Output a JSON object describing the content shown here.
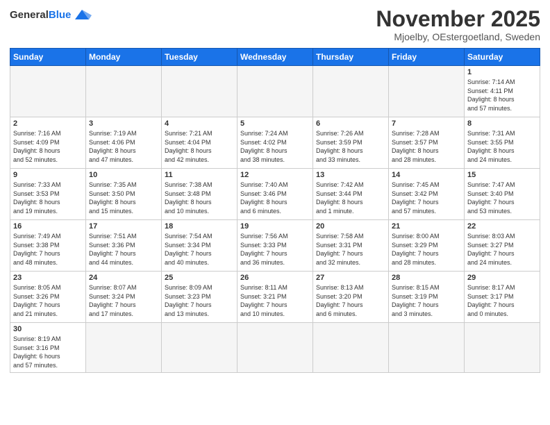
{
  "header": {
    "logo_general": "General",
    "logo_blue": "Blue",
    "month": "November 2025",
    "location": "Mjoelby, OEstergoetland, Sweden"
  },
  "weekdays": [
    "Sunday",
    "Monday",
    "Tuesday",
    "Wednesday",
    "Thursday",
    "Friday",
    "Saturday"
  ],
  "days": [
    {
      "num": "",
      "info": ""
    },
    {
      "num": "",
      "info": ""
    },
    {
      "num": "",
      "info": ""
    },
    {
      "num": "",
      "info": ""
    },
    {
      "num": "",
      "info": ""
    },
    {
      "num": "",
      "info": ""
    },
    {
      "num": "1",
      "info": "Sunrise: 7:14 AM\nSunset: 4:11 PM\nDaylight: 8 hours\nand 57 minutes."
    },
    {
      "num": "2",
      "info": "Sunrise: 7:16 AM\nSunset: 4:09 PM\nDaylight: 8 hours\nand 52 minutes."
    },
    {
      "num": "3",
      "info": "Sunrise: 7:19 AM\nSunset: 4:06 PM\nDaylight: 8 hours\nand 47 minutes."
    },
    {
      "num": "4",
      "info": "Sunrise: 7:21 AM\nSunset: 4:04 PM\nDaylight: 8 hours\nand 42 minutes."
    },
    {
      "num": "5",
      "info": "Sunrise: 7:24 AM\nSunset: 4:02 PM\nDaylight: 8 hours\nand 38 minutes."
    },
    {
      "num": "6",
      "info": "Sunrise: 7:26 AM\nSunset: 3:59 PM\nDaylight: 8 hours\nand 33 minutes."
    },
    {
      "num": "7",
      "info": "Sunrise: 7:28 AM\nSunset: 3:57 PM\nDaylight: 8 hours\nand 28 minutes."
    },
    {
      "num": "8",
      "info": "Sunrise: 7:31 AM\nSunset: 3:55 PM\nDaylight: 8 hours\nand 24 minutes."
    },
    {
      "num": "9",
      "info": "Sunrise: 7:33 AM\nSunset: 3:53 PM\nDaylight: 8 hours\nand 19 minutes."
    },
    {
      "num": "10",
      "info": "Sunrise: 7:35 AM\nSunset: 3:50 PM\nDaylight: 8 hours\nand 15 minutes."
    },
    {
      "num": "11",
      "info": "Sunrise: 7:38 AM\nSunset: 3:48 PM\nDaylight: 8 hours\nand 10 minutes."
    },
    {
      "num": "12",
      "info": "Sunrise: 7:40 AM\nSunset: 3:46 PM\nDaylight: 8 hours\nand 6 minutes."
    },
    {
      "num": "13",
      "info": "Sunrise: 7:42 AM\nSunset: 3:44 PM\nDaylight: 8 hours\nand 1 minute."
    },
    {
      "num": "14",
      "info": "Sunrise: 7:45 AM\nSunset: 3:42 PM\nDaylight: 7 hours\nand 57 minutes."
    },
    {
      "num": "15",
      "info": "Sunrise: 7:47 AM\nSunset: 3:40 PM\nDaylight: 7 hours\nand 53 minutes."
    },
    {
      "num": "16",
      "info": "Sunrise: 7:49 AM\nSunset: 3:38 PM\nDaylight: 7 hours\nand 48 minutes."
    },
    {
      "num": "17",
      "info": "Sunrise: 7:51 AM\nSunset: 3:36 PM\nDaylight: 7 hours\nand 44 minutes."
    },
    {
      "num": "18",
      "info": "Sunrise: 7:54 AM\nSunset: 3:34 PM\nDaylight: 7 hours\nand 40 minutes."
    },
    {
      "num": "19",
      "info": "Sunrise: 7:56 AM\nSunset: 3:33 PM\nDaylight: 7 hours\nand 36 minutes."
    },
    {
      "num": "20",
      "info": "Sunrise: 7:58 AM\nSunset: 3:31 PM\nDaylight: 7 hours\nand 32 minutes."
    },
    {
      "num": "21",
      "info": "Sunrise: 8:00 AM\nSunset: 3:29 PM\nDaylight: 7 hours\nand 28 minutes."
    },
    {
      "num": "22",
      "info": "Sunrise: 8:03 AM\nSunset: 3:27 PM\nDaylight: 7 hours\nand 24 minutes."
    },
    {
      "num": "23",
      "info": "Sunrise: 8:05 AM\nSunset: 3:26 PM\nDaylight: 7 hours\nand 21 minutes."
    },
    {
      "num": "24",
      "info": "Sunrise: 8:07 AM\nSunset: 3:24 PM\nDaylight: 7 hours\nand 17 minutes."
    },
    {
      "num": "25",
      "info": "Sunrise: 8:09 AM\nSunset: 3:23 PM\nDaylight: 7 hours\nand 13 minutes."
    },
    {
      "num": "26",
      "info": "Sunrise: 8:11 AM\nSunset: 3:21 PM\nDaylight: 7 hours\nand 10 minutes."
    },
    {
      "num": "27",
      "info": "Sunrise: 8:13 AM\nSunset: 3:20 PM\nDaylight: 7 hours\nand 6 minutes."
    },
    {
      "num": "28",
      "info": "Sunrise: 8:15 AM\nSunset: 3:19 PM\nDaylight: 7 hours\nand 3 minutes."
    },
    {
      "num": "29",
      "info": "Sunrise: 8:17 AM\nSunset: 3:17 PM\nDaylight: 7 hours\nand 0 minutes."
    },
    {
      "num": "30",
      "info": "Sunrise: 8:19 AM\nSunset: 3:16 PM\nDaylight: 6 hours\nand 57 minutes."
    },
    {
      "num": "",
      "info": ""
    },
    {
      "num": "",
      "info": ""
    },
    {
      "num": "",
      "info": ""
    },
    {
      "num": "",
      "info": ""
    },
    {
      "num": "",
      "info": ""
    },
    {
      "num": "",
      "info": ""
    }
  ]
}
